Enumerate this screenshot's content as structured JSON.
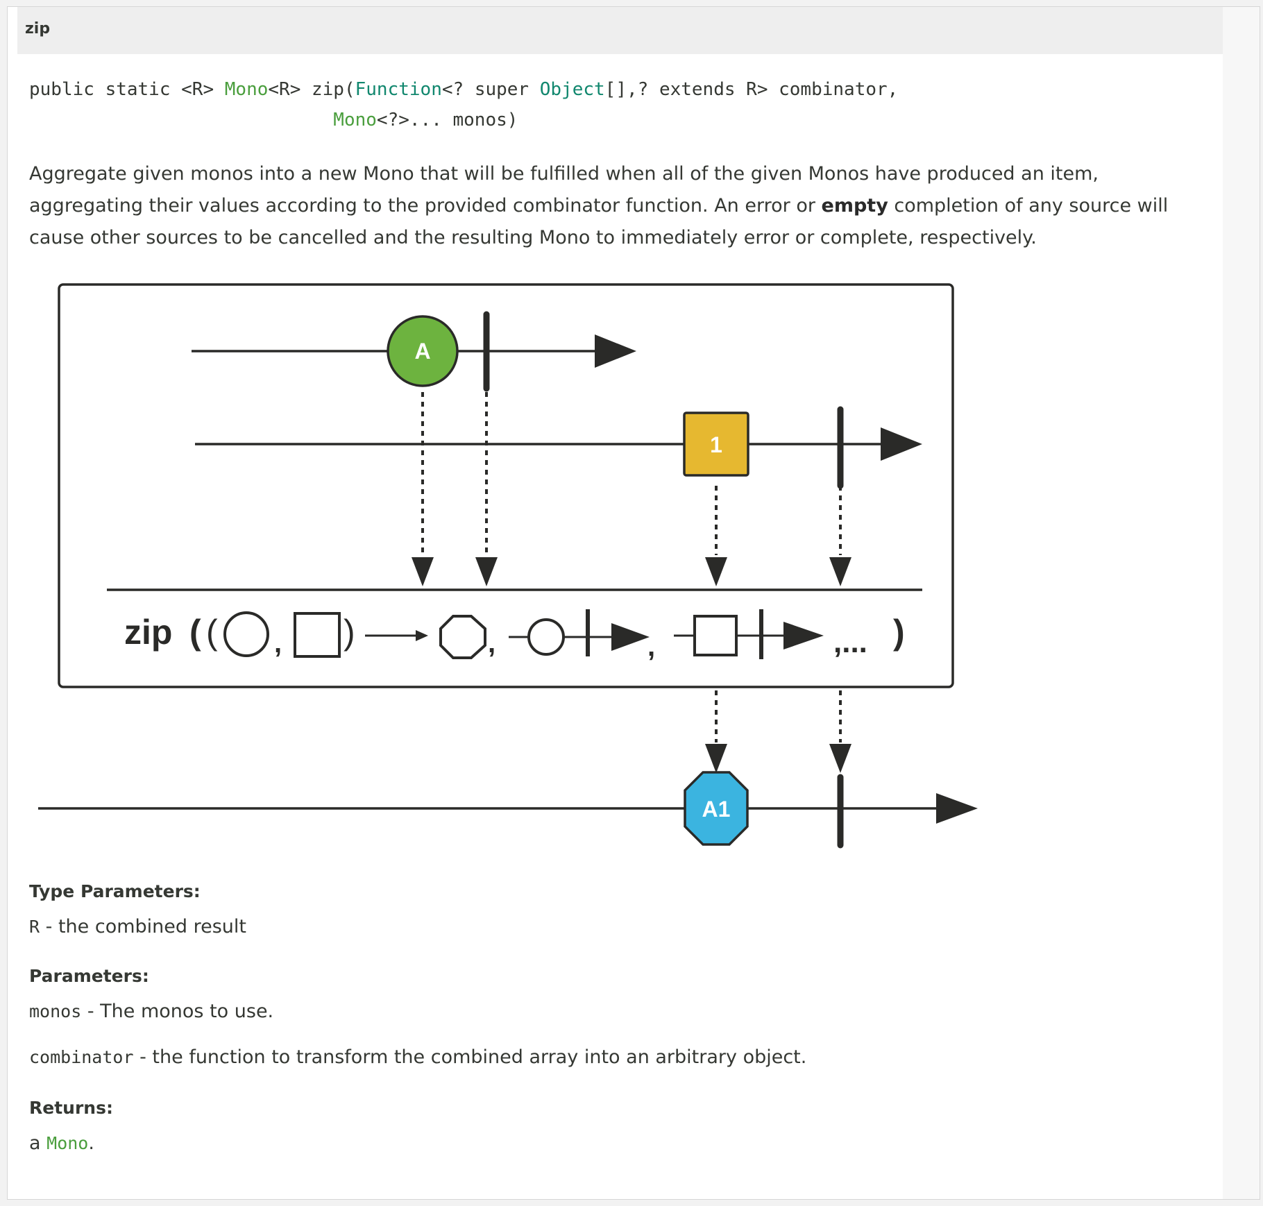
{
  "header": {
    "title": "zip"
  },
  "signature": {
    "line1": {
      "prefix": "public static <R> ",
      "mono_link": "Mono",
      "after_mono": "<R> zip(",
      "function_type": "Function",
      "after_function": "<? super ",
      "object_type": "Object",
      "after_object": "[],? extends R> combinator,"
    },
    "line2": {
      "indent": "                            ",
      "mono_link": "Mono",
      "rest": "<?>... monos)"
    }
  },
  "description": {
    "part1": "Aggregate given monos into a new Mono that will be fulfilled when all of the given Monos have produced an item, aggregating their values according to the provided combinator function. An error or ",
    "bold": "empty",
    "part2": " completion of any source will cause other sources to be cancelled and the resulting Mono to immediately error or complete, respectively."
  },
  "diagram": {
    "source1_item": "A",
    "source2_item": "1",
    "result_item": "A1",
    "operator_label": "zip",
    "ellipsis": ",...",
    "colors": {
      "green": "#6db33f",
      "yellow": "#e6b830",
      "blue": "#3bb4e0",
      "stroke": "#2a2a28"
    }
  },
  "type_parameters": {
    "heading": "Type Parameters:",
    "items": [
      {
        "name": "R",
        "desc": " - the combined result"
      }
    ]
  },
  "parameters": {
    "heading": "Parameters:",
    "items": [
      {
        "name": "monos",
        "desc": " - The monos to use."
      },
      {
        "name": "combinator",
        "desc": " - the function to transform the combined array into an arbitrary object."
      }
    ]
  },
  "returns": {
    "heading": "Returns:",
    "prefix": "a ",
    "link": "Mono",
    "suffix": "."
  }
}
